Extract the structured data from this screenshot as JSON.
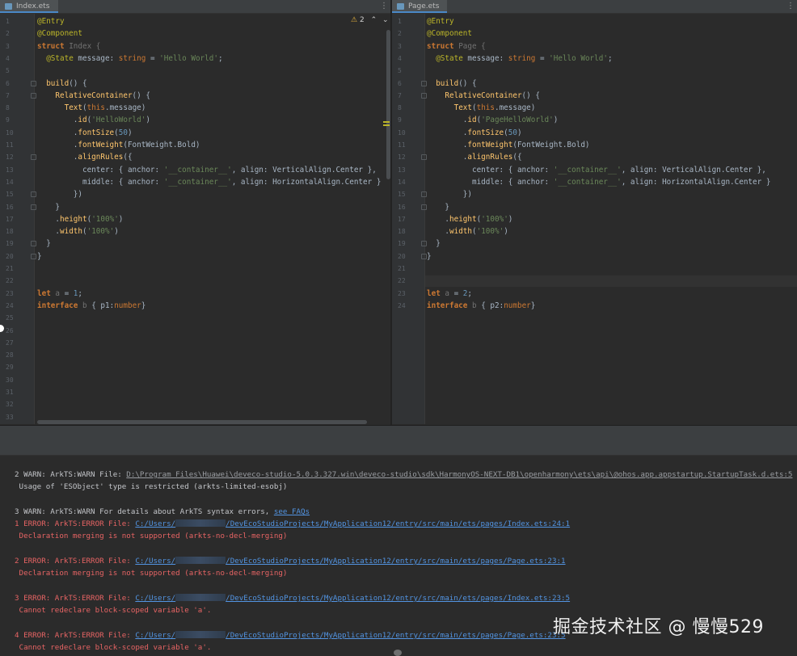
{
  "tabs": {
    "left": {
      "label": "Index.ets"
    },
    "right": {
      "label": "Page.ets"
    }
  },
  "inspection": {
    "warning_count": "2"
  },
  "left_editor": {
    "line_numbers": [
      "1",
      "2",
      "3",
      "4",
      "5",
      "6",
      "7",
      "8",
      "9",
      "10",
      "11",
      "12",
      "13",
      "14",
      "15",
      "16",
      "17",
      "18",
      "19",
      "20",
      "21",
      "22",
      "23",
      "24",
      "25",
      "26",
      "27",
      "28",
      "29",
      "30",
      "31",
      "32",
      "33"
    ],
    "lines": [
      [
        {
          "t": "@Entry",
          "c": "ann"
        }
      ],
      [
        {
          "t": "@Component",
          "c": "ann"
        }
      ],
      [
        {
          "t": "struct ",
          "c": "kw"
        },
        {
          "t": "Index {",
          "c": "dim"
        }
      ],
      [
        {
          "t": "  ",
          "c": "plain"
        },
        {
          "t": "@State",
          "c": "ann"
        },
        {
          "t": " message: ",
          "c": "plain"
        },
        {
          "t": "string",
          "c": "kwn"
        },
        {
          "t": " = ",
          "c": "plain"
        },
        {
          "t": "'Hello World'",
          "c": "str"
        },
        {
          "t": ";",
          "c": "plain"
        }
      ],
      [],
      [
        {
          "t": "  ",
          "c": "plain"
        },
        {
          "t": "build",
          "c": "fn"
        },
        {
          "t": "() {",
          "c": "plain"
        }
      ],
      [
        {
          "t": "    ",
          "c": "plain"
        },
        {
          "t": "RelativeContainer",
          "c": "fn"
        },
        {
          "t": "() {",
          "c": "plain"
        }
      ],
      [
        {
          "t": "      ",
          "c": "plain"
        },
        {
          "t": "Text",
          "c": "fn"
        },
        {
          "t": "(",
          "c": "plain"
        },
        {
          "t": "this",
          "c": "kwn"
        },
        {
          "t": ".message)",
          "c": "plain"
        }
      ],
      [
        {
          "t": "        .",
          "c": "plain"
        },
        {
          "t": "id",
          "c": "fn"
        },
        {
          "t": "(",
          "c": "plain"
        },
        {
          "t": "'HelloWorld'",
          "c": "str"
        },
        {
          "t": ")",
          "c": "plain"
        }
      ],
      [
        {
          "t": "        .",
          "c": "plain"
        },
        {
          "t": "fontSize",
          "c": "fn"
        },
        {
          "t": "(",
          "c": "plain"
        },
        {
          "t": "50",
          "c": "num"
        },
        {
          "t": ")",
          "c": "plain"
        }
      ],
      [
        {
          "t": "        .",
          "c": "plain"
        },
        {
          "t": "fontWeight",
          "c": "fn"
        },
        {
          "t": "(FontWeight.Bold)",
          "c": "plain"
        }
      ],
      [
        {
          "t": "        .",
          "c": "plain"
        },
        {
          "t": "alignRules",
          "c": "fn"
        },
        {
          "t": "({",
          "c": "plain"
        }
      ],
      [
        {
          "t": "          center: { anchor: ",
          "c": "plain"
        },
        {
          "t": "'__container__'",
          "c": "str"
        },
        {
          "t": ", align: VerticalAlign.Center },",
          "c": "plain"
        }
      ],
      [
        {
          "t": "          middle: { anchor: ",
          "c": "plain"
        },
        {
          "t": "'__container__'",
          "c": "str"
        },
        {
          "t": ", align: HorizontalAlign.Center }",
          "c": "plain"
        }
      ],
      [
        {
          "t": "        })",
          "c": "plain"
        }
      ],
      [
        {
          "t": "    }",
          "c": "plain"
        }
      ],
      [
        {
          "t": "    .",
          "c": "plain"
        },
        {
          "t": "height",
          "c": "fn"
        },
        {
          "t": "(",
          "c": "plain"
        },
        {
          "t": "'100%'",
          "c": "str"
        },
        {
          "t": ")",
          "c": "plain"
        }
      ],
      [
        {
          "t": "    .",
          "c": "plain"
        },
        {
          "t": "width",
          "c": "fn"
        },
        {
          "t": "(",
          "c": "plain"
        },
        {
          "t": "'100%'",
          "c": "str"
        },
        {
          "t": ")",
          "c": "plain"
        }
      ],
      [
        {
          "t": "  }",
          "c": "plain"
        }
      ],
      [
        {
          "t": "}",
          "c": "plain"
        }
      ],
      [],
      [],
      [
        {
          "t": "let ",
          "c": "kw"
        },
        {
          "t": "a",
          "c": "dim"
        },
        {
          "t": " = ",
          "c": "plain"
        },
        {
          "t": "1",
          "c": "num"
        },
        {
          "t": ";",
          "c": "plain"
        }
      ],
      [
        {
          "t": "interface ",
          "c": "kw"
        },
        {
          "t": "b",
          "c": "dim"
        },
        {
          "t": " { p1:",
          "c": "plain"
        },
        {
          "t": "number",
          "c": "kwn"
        },
        {
          "t": "}",
          "c": "plain"
        }
      ]
    ]
  },
  "right_editor": {
    "line_numbers": [
      "1",
      "2",
      "3",
      "4",
      "5",
      "6",
      "7",
      "8",
      "9",
      "10",
      "11",
      "12",
      "13",
      "14",
      "15",
      "16",
      "17",
      "18",
      "19",
      "20",
      "21",
      "22",
      "23",
      "24"
    ],
    "lines": [
      [
        {
          "t": "@Entry",
          "c": "ann"
        }
      ],
      [
        {
          "t": "@Component",
          "c": "ann"
        }
      ],
      [
        {
          "t": "struct ",
          "c": "kw"
        },
        {
          "t": "Page {",
          "c": "dim"
        }
      ],
      [
        {
          "t": "  ",
          "c": "plain"
        },
        {
          "t": "@State",
          "c": "ann"
        },
        {
          "t": " message: ",
          "c": "plain"
        },
        {
          "t": "string",
          "c": "kwn"
        },
        {
          "t": " = ",
          "c": "plain"
        },
        {
          "t": "'Hello World'",
          "c": "str"
        },
        {
          "t": ";",
          "c": "plain"
        }
      ],
      [],
      [
        {
          "t": "  ",
          "c": "plain"
        },
        {
          "t": "build",
          "c": "fn"
        },
        {
          "t": "() {",
          "c": "plain"
        }
      ],
      [
        {
          "t": "    ",
          "c": "plain"
        },
        {
          "t": "RelativeContainer",
          "c": "fn"
        },
        {
          "t": "() {",
          "c": "plain"
        }
      ],
      [
        {
          "t": "      ",
          "c": "plain"
        },
        {
          "t": "Text",
          "c": "fn"
        },
        {
          "t": "(",
          "c": "plain"
        },
        {
          "t": "this",
          "c": "kwn"
        },
        {
          "t": ".message)",
          "c": "plain"
        }
      ],
      [
        {
          "t": "        .",
          "c": "plain"
        },
        {
          "t": "id",
          "c": "fn"
        },
        {
          "t": "(",
          "c": "plain"
        },
        {
          "t": "'PageHelloWorld'",
          "c": "str"
        },
        {
          "t": ")",
          "c": "plain"
        }
      ],
      [
        {
          "t": "        .",
          "c": "plain"
        },
        {
          "t": "fontSize",
          "c": "fn"
        },
        {
          "t": "(",
          "c": "plain"
        },
        {
          "t": "50",
          "c": "num"
        },
        {
          "t": ")",
          "c": "plain"
        }
      ],
      [
        {
          "t": "        .",
          "c": "plain"
        },
        {
          "t": "fontWeight",
          "c": "fn"
        },
        {
          "t": "(FontWeight.Bold)",
          "c": "plain"
        }
      ],
      [
        {
          "t": "        .",
          "c": "plain"
        },
        {
          "t": "alignRules",
          "c": "fn"
        },
        {
          "t": "({",
          "c": "plain"
        }
      ],
      [
        {
          "t": "          center: { anchor: ",
          "c": "plain"
        },
        {
          "t": "'__container__'",
          "c": "str"
        },
        {
          "t": ", align: VerticalAlign.Center },",
          "c": "plain"
        }
      ],
      [
        {
          "t": "          middle: { anchor: ",
          "c": "plain"
        },
        {
          "t": "'__container__'",
          "c": "str"
        },
        {
          "t": ", align: HorizontalAlign.Center }",
          "c": "plain"
        }
      ],
      [
        {
          "t": "        })",
          "c": "plain"
        }
      ],
      [
        {
          "t": "    }",
          "c": "plain"
        }
      ],
      [
        {
          "t": "    .",
          "c": "plain"
        },
        {
          "t": "height",
          "c": "fn"
        },
        {
          "t": "(",
          "c": "plain"
        },
        {
          "t": "'100%'",
          "c": "str"
        },
        {
          "t": ")",
          "c": "plain"
        }
      ],
      [
        {
          "t": "    .",
          "c": "plain"
        },
        {
          "t": "width",
          "c": "fn"
        },
        {
          "t": "(",
          "c": "plain"
        },
        {
          "t": "'100%'",
          "c": "str"
        },
        {
          "t": ")",
          "c": "plain"
        }
      ],
      [
        {
          "t": "  }",
          "c": "plain"
        }
      ],
      [
        {
          "t": "}",
          "c": "plain"
        }
      ],
      [],
      [],
      [
        {
          "t": "let ",
          "c": "kw"
        },
        {
          "t": "a",
          "c": "dim"
        },
        {
          "t": " = ",
          "c": "plain"
        },
        {
          "t": "2",
          "c": "num"
        },
        {
          "t": ";",
          "c": "plain"
        }
      ],
      [
        {
          "t": "interface ",
          "c": "kw"
        },
        {
          "t": "b",
          "c": "dim"
        },
        {
          "t": " { p2:",
          "c": "plain"
        },
        {
          "t": "number",
          "c": "kwn"
        },
        {
          "t": "}",
          "c": "plain"
        }
      ]
    ]
  },
  "log": {
    "entries": [
      {
        "kind": "warn",
        "parts": [
          {
            "t": "2 WARN: ArkTS:WARN File: ",
            "s": "plain"
          },
          {
            "t": "D:\\Program Files\\Huawei\\deveco-studio-5.0.3.327.win\\deveco-studio\\sdk\\HarmonyOS-NEXT-DB1\\openharmony\\ets\\api\\@ohos.app.appstartup.StartupTask.d.ets:5",
            "s": "linkdim"
          }
        ]
      },
      {
        "kind": "msgwarn",
        "parts": [
          {
            "t": " Usage of 'ESObject' type is restricted (arkts-limited-esobj)",
            "s": "plain"
          }
        ]
      },
      {
        "kind": "warn",
        "parts": [
          {
            "t": "3 WARN: ArkTS:WARN For details about ArkTS syntax errors, ",
            "s": "plain"
          },
          {
            "t": "see FAQs",
            "s": "link"
          }
        ]
      },
      {
        "kind": "err",
        "parts": [
          {
            "t": "1 ERROR: ArkTS:ERROR File: ",
            "s": "plain"
          },
          {
            "t": "C:/Users/",
            "s": "link"
          },
          {
            "t": "",
            "s": "redact"
          },
          {
            "t": "/DevEcoStudioProjects/MyApplication12/entry/src/main/ets/pages/Index.ets:24:1",
            "s": "link"
          }
        ]
      },
      {
        "kind": "err",
        "parts": [
          {
            "t": " Declaration merging is not supported (arkts-no-decl-merging)",
            "s": "plain"
          }
        ]
      },
      {
        "kind": "err",
        "parts": [
          {
            "t": "2 ERROR: ArkTS:ERROR File: ",
            "s": "plain"
          },
          {
            "t": "C:/Users/",
            "s": "link"
          },
          {
            "t": "",
            "s": "redact"
          },
          {
            "t": "/DevEcoStudioProjects/MyApplication12/entry/src/main/ets/pages/Page.ets:23:1",
            "s": "link"
          }
        ]
      },
      {
        "kind": "err",
        "parts": [
          {
            "t": " Declaration merging is not supported (arkts-no-decl-merging)",
            "s": "plain"
          }
        ]
      },
      {
        "kind": "err",
        "parts": [
          {
            "t": "3 ERROR: ArkTS:ERROR File: ",
            "s": "plain"
          },
          {
            "t": "C:/Users/",
            "s": "link"
          },
          {
            "t": "",
            "s": "redact"
          },
          {
            "t": "/DevEcoStudioProjects/MyApplication12/entry/src/main/ets/pages/Index.ets:23:5",
            "s": "link"
          }
        ]
      },
      {
        "kind": "err",
        "parts": [
          {
            "t": " Cannot redeclare block-scoped variable 'a'.",
            "s": "plain"
          }
        ]
      },
      {
        "kind": "err",
        "parts": [
          {
            "t": "4 ERROR: ArkTS:ERROR File: ",
            "s": "plain"
          },
          {
            "t": "C:/Users/",
            "s": "link"
          },
          {
            "t": "",
            "s": "redact"
          },
          {
            "t": "/DevEcoStudioProjects/MyApplication12/entry/src/main/ets/pages/Page.ets:23:5",
            "s": "link"
          }
        ]
      },
      {
        "kind": "err",
        "parts": [
          {
            "t": " Cannot redeclare block-scoped variable 'a'.",
            "s": "plain"
          }
        ]
      }
    ]
  },
  "watermark": {
    "text": "掘金技术社区 @ 慢慢529"
  },
  "colors": {
    "error": "#e76464",
    "warning_triangle": "#e4b13c",
    "link": "#5294e2",
    "background": "#2b2b2b"
  },
  "icons": {
    "tab_file": "file-icon",
    "kebab": "more-vertical-icon",
    "warning": "warning-triangle-icon",
    "up": "chevron-up-icon",
    "down": "chevron-down-icon"
  }
}
